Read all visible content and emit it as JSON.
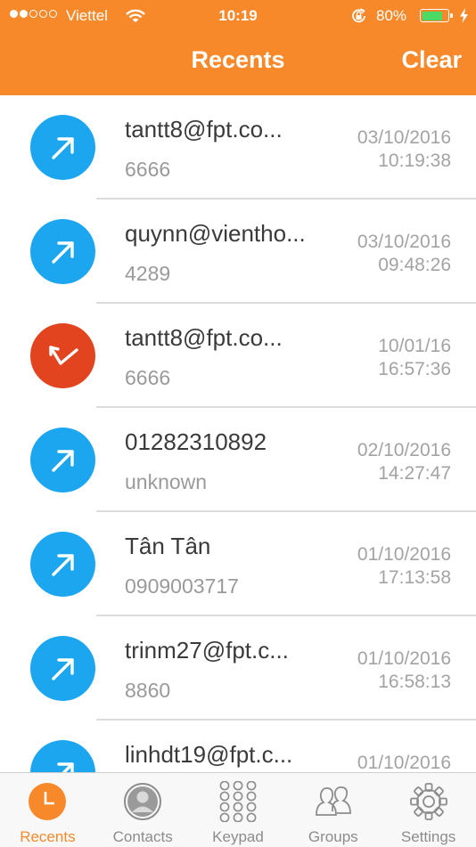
{
  "status": {
    "carrier": "Viettel",
    "time": "10:19",
    "battery": "80%",
    "battery_level": 0.8
  },
  "header": {
    "title": "Recents",
    "clear_label": "Clear"
  },
  "calls": [
    {
      "name": "tantt8@fpt.co...",
      "number": "6666",
      "date": "03/10/2016",
      "time": "10:19:38",
      "type": "outgoing"
    },
    {
      "name": "quynn@vientho...",
      "number": "4289",
      "date": "03/10/2016",
      "time": "09:48:26",
      "type": "outgoing"
    },
    {
      "name": "tantt8@fpt.co...",
      "number": "6666",
      "date": "10/01/16",
      "time": "16:57:36",
      "type": "missed"
    },
    {
      "name": "01282310892",
      "number": "unknown",
      "date": "02/10/2016",
      "time": "14:27:47",
      "type": "outgoing"
    },
    {
      "name": "Tân Tân",
      "number": "0909003717",
      "date": "01/10/2016",
      "time": "17:13:58",
      "type": "outgoing"
    },
    {
      "name": "trinm27@fpt.c...",
      "number": "8860",
      "date": "01/10/2016",
      "time": "16:58:13",
      "type": "outgoing"
    },
    {
      "name": "linhdt19@fpt.c...",
      "number": "",
      "date": "01/10/2016",
      "time": "",
      "type": "outgoing"
    }
  ],
  "tabs": [
    {
      "label": "Recents",
      "icon": "clock-icon",
      "active": true
    },
    {
      "label": "Contacts",
      "icon": "person-icon",
      "active": false
    },
    {
      "label": "Keypad",
      "icon": "keypad-icon",
      "active": false
    },
    {
      "label": "Groups",
      "icon": "group-icon",
      "active": false
    },
    {
      "label": "Settings",
      "icon": "gear-icon",
      "active": false
    }
  ],
  "colors": {
    "accent": "#f7892a",
    "outgoing": "#1da6f0",
    "missed": "#e2441f"
  }
}
